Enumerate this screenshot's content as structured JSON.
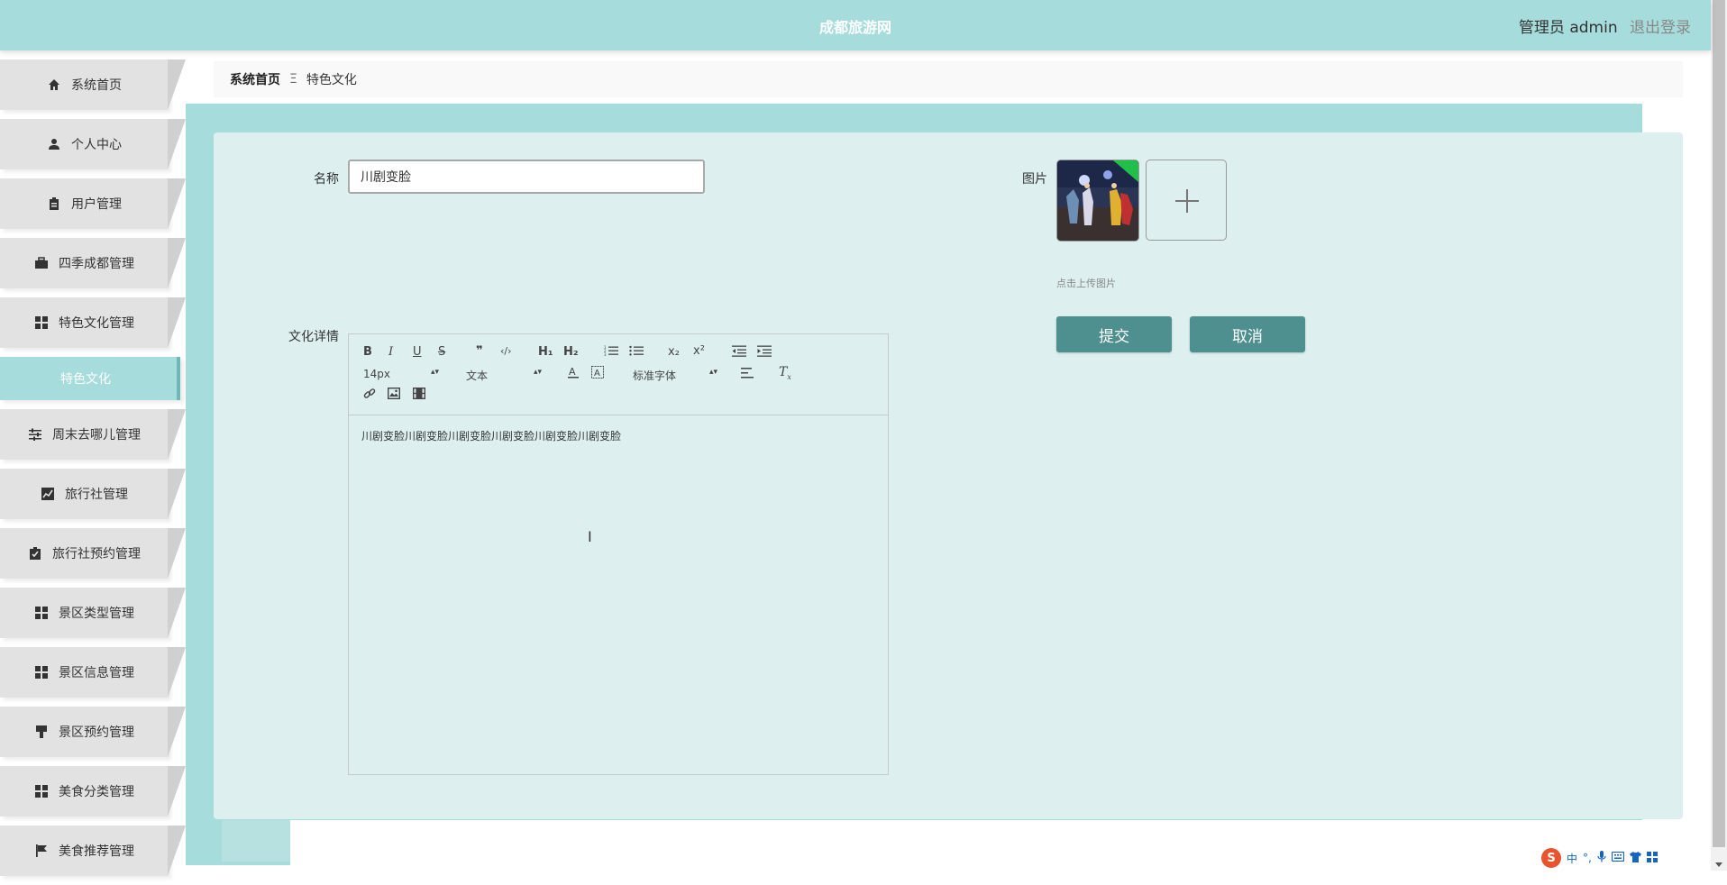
{
  "header": {
    "site_title": "成都旅游网",
    "user_role": "管理员 admin",
    "logout": "退出登录"
  },
  "sidebar": {
    "items": [
      {
        "label": "系统首页",
        "icon": "home-icon"
      },
      {
        "label": "个人中心",
        "icon": "user-icon"
      },
      {
        "label": "用户管理",
        "icon": "clipboard-icon"
      },
      {
        "label": "四季成都管理",
        "icon": "briefcase-icon"
      },
      {
        "label": "特色文化管理",
        "icon": "grid-icon"
      },
      {
        "label": "特色文化",
        "icon": "",
        "active": true
      },
      {
        "label": "周末去哪儿管理",
        "icon": "sliders-icon"
      },
      {
        "label": "旅行社管理",
        "icon": "chart-icon"
      },
      {
        "label": "旅行社预约管理",
        "icon": "checklist-icon"
      },
      {
        "label": "景区类型管理",
        "icon": "grid-icon"
      },
      {
        "label": "景区信息管理",
        "icon": "grid-icon"
      },
      {
        "label": "景区预约管理",
        "icon": "brush-icon"
      },
      {
        "label": "美食分类管理",
        "icon": "grid-icon"
      },
      {
        "label": "美食推荐管理",
        "icon": "flag-icon"
      }
    ]
  },
  "breadcrumb": {
    "home": "系统首页",
    "separator": "Ξ",
    "current": "特色文化"
  },
  "form": {
    "name_label": "名称",
    "name_value": "川剧变脸",
    "image_label": "图片",
    "upload_hint": "点击上传图片",
    "detail_label": "文化详情",
    "submit_label": "提交",
    "cancel_label": "取消"
  },
  "editor": {
    "font_size": "14px",
    "block_format": "文本",
    "font_family": "标准字体",
    "content": "川剧变脸川剧变脸川剧变脸川剧变脸川剧变脸川剧变脸",
    "buttons_row1": [
      "B",
      "I",
      "U",
      "S",
      "❞",
      "‹/›",
      "H₁",
      "H₂",
      "ordered-list",
      "bullet-list",
      "x₂",
      "x²",
      "outdent",
      "indent"
    ]
  },
  "ime": {
    "logo": "S",
    "mode": "中",
    "punct": "°,"
  },
  "colors": {
    "header": "#a6dcdc",
    "panel": "#ddf0ef",
    "button": "#4e8f8f",
    "sidebar_item": "#e2e2e2",
    "active_item": "#a6dcdc"
  }
}
